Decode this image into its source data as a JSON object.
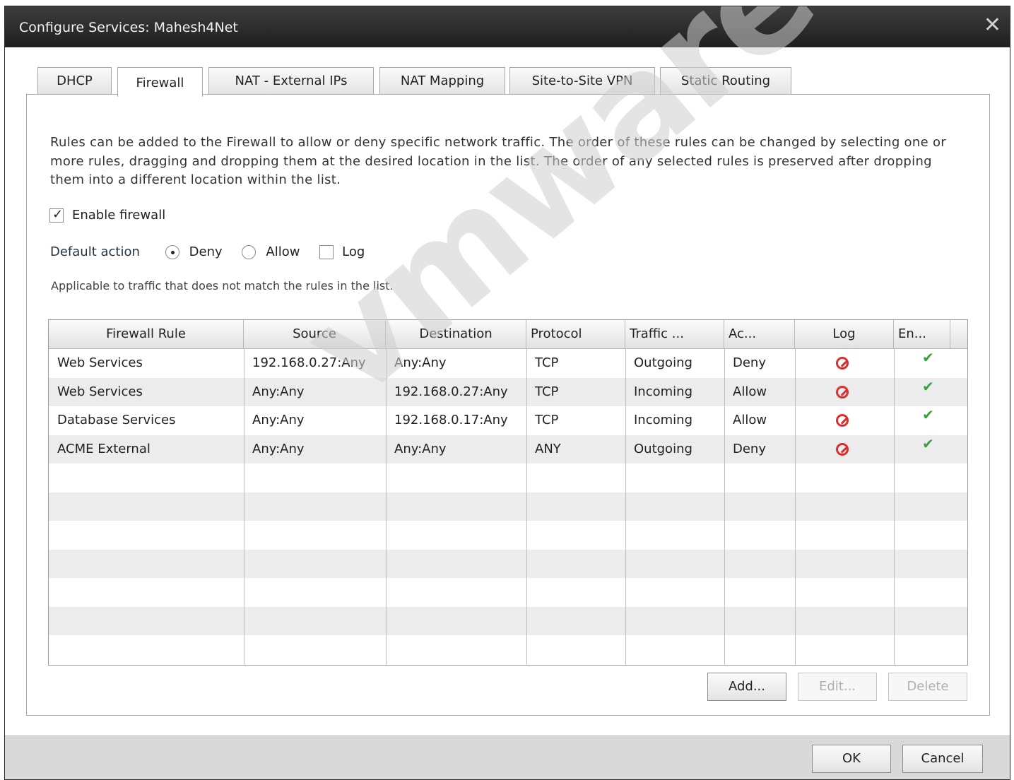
{
  "window": {
    "title": "Configure Services: Mahesh4Net",
    "close_icon": "close-icon"
  },
  "tabs": [
    {
      "label": "DHCP",
      "active": false
    },
    {
      "label": "Firewall",
      "active": true
    },
    {
      "label": "NAT - External IPs",
      "active": false
    },
    {
      "label": "NAT Mapping",
      "active": false
    },
    {
      "label": "Site-to-Site VPN",
      "active": false
    },
    {
      "label": "Static Routing",
      "active": false
    }
  ],
  "firewall": {
    "description": "Rules can be added to the Firewall to allow or deny specific network traffic. The order of these rules can be changed by selecting one or more rules, dragging and dropping them at the desired location in the list. The order of any selected rules is preserved after dropping them into a different location within the list.",
    "enable_label": "Enable firewall",
    "enable_checked": true,
    "default_action_label": "Default action",
    "deny_label": "Deny",
    "allow_label": "Allow",
    "log_label": "Log",
    "default_action_selected": "Deny",
    "log_checked": false,
    "note": "Applicable to traffic that does not match the rules in the list."
  },
  "table": {
    "columns": [
      "Firewall Rule",
      "Source",
      "Destination",
      "Protocol",
      "Traffic ...",
      "Ac...",
      "Log",
      "En..."
    ],
    "rows": [
      {
        "rule": "Web Services",
        "source": "192.168.0.27:Any",
        "destination": "Any:Any",
        "protocol": "TCP",
        "traffic": "Outgoing",
        "action": "Deny",
        "log": false,
        "enabled": true
      },
      {
        "rule": "Web Services",
        "source": "Any:Any",
        "destination": "192.168.0.27:Any",
        "protocol": "TCP",
        "traffic": "Incoming",
        "action": "Allow",
        "log": false,
        "enabled": true
      },
      {
        "rule": "Database Services",
        "source": "Any:Any",
        "destination": "192.168.0.17:Any",
        "protocol": "TCP",
        "traffic": "Incoming",
        "action": "Allow",
        "log": false,
        "enabled": true
      },
      {
        "rule": "ACME External",
        "source": "Any:Any",
        "destination": "Any:Any",
        "protocol": "ANY",
        "traffic": "Outgoing",
        "action": "Deny",
        "log": false,
        "enabled": true
      }
    ]
  },
  "buttons": {
    "add": "Add...",
    "edit": "Edit...",
    "delete": "Delete",
    "ok": "OK",
    "cancel": "Cancel"
  },
  "watermark": "vmware",
  "colors": {
    "titlebar": "#2b2b2b",
    "log_no": "#d9302e",
    "enabled_ok": "#3aa23a"
  }
}
